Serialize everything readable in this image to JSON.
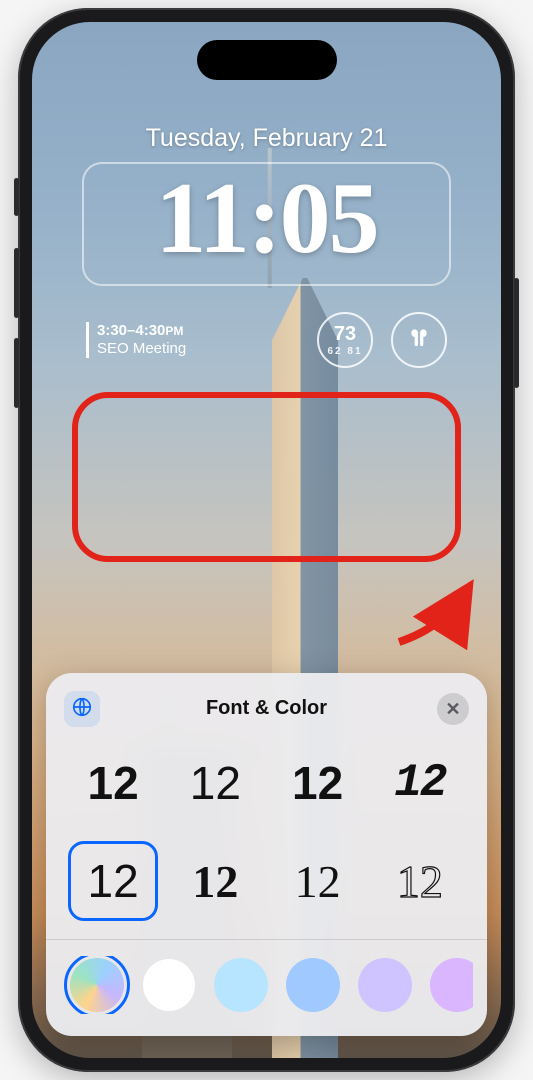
{
  "lockscreen": {
    "date": "Tuesday, February 21",
    "time": "11:05",
    "event": {
      "time_range": "3:30–4:30",
      "period": "PM",
      "title": "SEO Meeting"
    },
    "weather": {
      "current": "73",
      "low": "62",
      "high": "81"
    }
  },
  "sheet": {
    "title": "Font & Color",
    "sample": "12",
    "selected_font_index": 4,
    "colors": [
      {
        "name": "gradient",
        "css": "conic-gradient(from 210deg,#ffd48a,#9be3c3,#9cd0ff,#c6b7ff,#ffd48a)",
        "selected": true
      },
      {
        "name": "white",
        "css": "#ffffff"
      },
      {
        "name": "light-blue",
        "css": "#b7e4ff"
      },
      {
        "name": "sky-blue",
        "css": "#9fc9ff"
      },
      {
        "name": "lavender",
        "css": "#cfc4ff"
      },
      {
        "name": "violet",
        "css": "#d9b6ff"
      },
      {
        "name": "pink",
        "css": "#ffc1d6"
      }
    ]
  }
}
